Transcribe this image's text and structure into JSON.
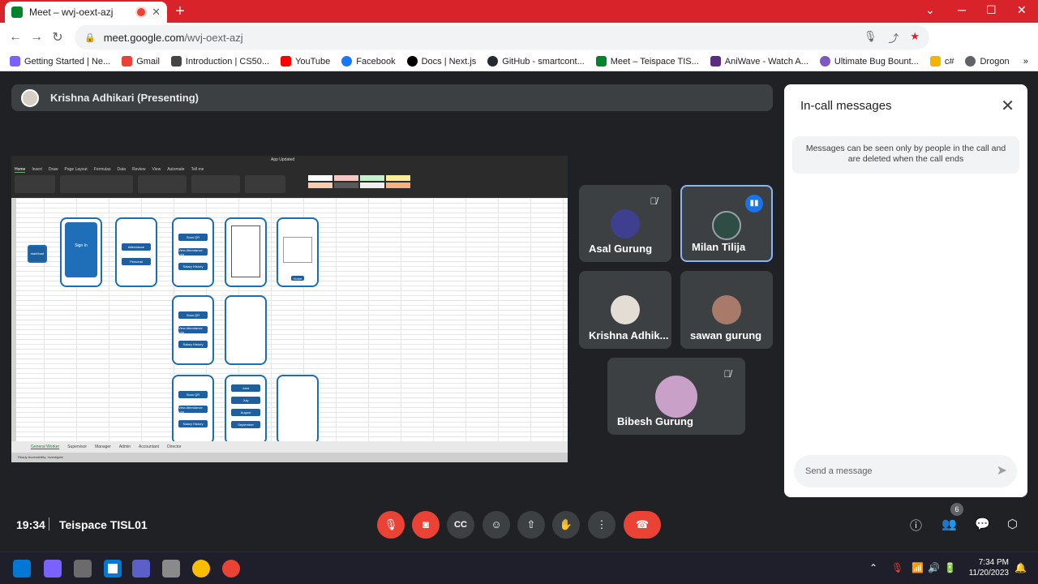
{
  "browser": {
    "tab_title": "Meet – wvj-oext-azj",
    "url_host": "meet.google.com",
    "url_path": "/wvj-oext-azj",
    "bookmarks": [
      {
        "label": "Getting Started | Ne...",
        "color": "#7b61ff"
      },
      {
        "label": "Gmail",
        "color": "#ea4335"
      },
      {
        "label": "Introduction | CS50...",
        "color": "#444444"
      },
      {
        "label": "YouTube",
        "color": "#ff0000"
      },
      {
        "label": "Facebook",
        "color": "#1877f2"
      },
      {
        "label": "Docs | Next.js",
        "color": "#000000"
      },
      {
        "label": "GitHub - smartcont...",
        "color": "#24292f"
      },
      {
        "label": "Meet – Teispace TIS...",
        "color": "#00832d"
      },
      {
        "label": "AniWave - Watch A...",
        "color": "#5a2d82"
      },
      {
        "label": "Ultimate Bug Bount...",
        "color": "#7e57c2"
      },
      {
        "label": "c#",
        "color": "#f4b400"
      },
      {
        "label": "Drogon",
        "color": "#5f6368"
      }
    ]
  },
  "presenter": {
    "label": "Krishna Adhikari (Presenting)"
  },
  "shared_screen": {
    "workbook_title": "App Updated",
    "ribbon_tabs": [
      "Home",
      "Insert",
      "Draw",
      "Page Layout",
      "Formulas",
      "Data",
      "Review",
      "View",
      "Automate",
      "Tell me"
    ],
    "active_tab": "Home",
    "start_label": "start/load",
    "signin_label": "Sign In",
    "attendance_label": "Attendance",
    "personal_label": "Personal",
    "scan_qr": "Scan QR",
    "view_log": "View Attendance Log",
    "salary_history": "Salary History",
    "home_label": "Home",
    "months": [
      "June",
      "July",
      "August",
      "September"
    ],
    "sheet_tabs": [
      "General Worker",
      "Supervisor",
      "Manager",
      "Admin",
      "Accountant",
      "Director"
    ],
    "active_sheet": "General Worker",
    "status_text": "Ready   Accessibility: Investigate"
  },
  "participants": [
    {
      "name": "Asal Gurung",
      "muted": true,
      "avatar_color": "#3f3f8f"
    },
    {
      "name": "Milan Tilija",
      "muted": false,
      "speaking": true,
      "avatar_color": "#2e4d45"
    },
    {
      "name": "Krishna Adhik...",
      "muted": false,
      "avatar_color": "#e4ddd5"
    },
    {
      "name": "sawan gurung",
      "muted": false,
      "avatar_color": "#a87a6a"
    },
    {
      "name": "Bibesh Gurung",
      "muted": true,
      "avatar_color": "#c9a0c8"
    }
  ],
  "chat": {
    "title": "In-call messages",
    "notice": "Messages can be seen only by people in the call and are deleted when the call ends",
    "placeholder": "Send a message"
  },
  "meeting": {
    "time": "19:34",
    "name": "Teispace TISL01",
    "people_count": "6"
  },
  "taskbar": {
    "time": "7:34 PM",
    "date": "11/20/2023"
  }
}
